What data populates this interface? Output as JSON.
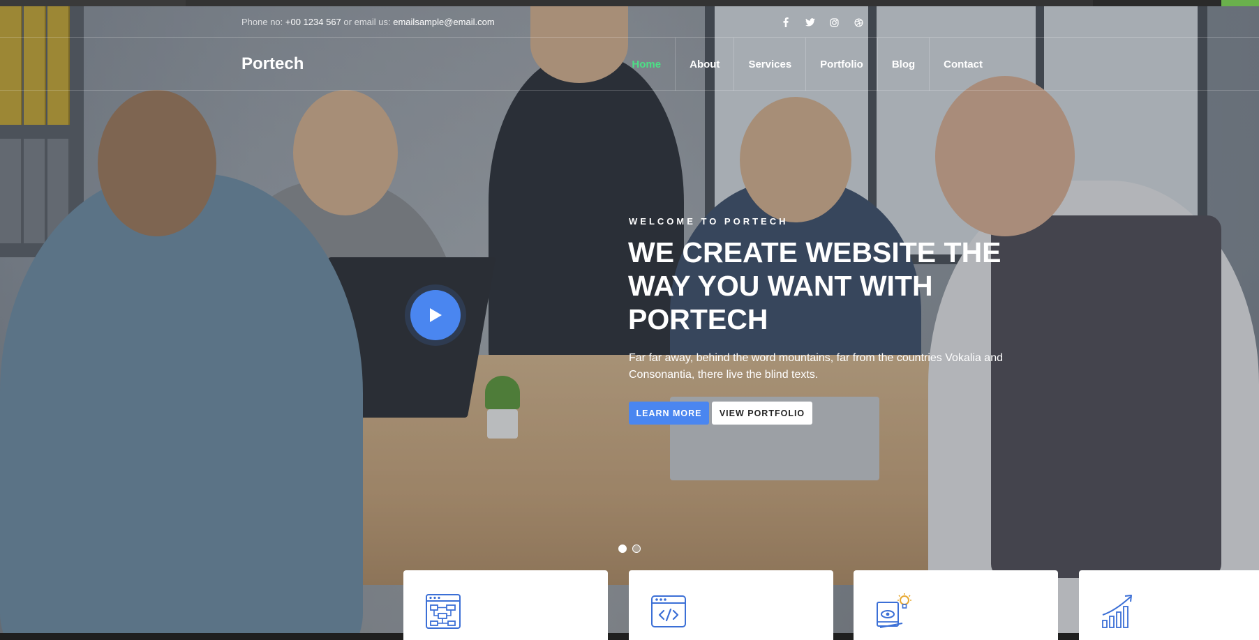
{
  "contact": {
    "phone_label": "Phone no:",
    "phone": "+00 1234 567",
    "email_label": "or email us:",
    "email": "emailsample@email.com"
  },
  "social": [
    {
      "icon": "facebook-icon"
    },
    {
      "icon": "twitter-icon"
    },
    {
      "icon": "instagram-icon"
    },
    {
      "icon": "dribbble-icon"
    }
  ],
  "brand": "Portech",
  "nav": [
    "Home",
    "About",
    "Services",
    "Portfolio",
    "Blog",
    "Contact"
  ],
  "hero": {
    "eyebrow": "WELCOME TO PORTECH",
    "headline": "WE CREATE WEBSITE THE WAY YOU WANT WITH PORTECH",
    "lead": "Far far away, behind the word mountains, far from the countries Vokalia and Consonantia, there live the blind texts.",
    "primary_button": "LEARN MORE",
    "secondary_button": "VIEW PORTFOLIO",
    "slide_count": 2,
    "active_slide": 1
  },
  "cards": [
    {
      "icon": "workflow-icon"
    },
    {
      "icon": "code-window-icon"
    },
    {
      "icon": "design-idea-icon"
    },
    {
      "icon": "growth-chart-icon"
    }
  ],
  "colors": {
    "accent_blue": "#4a86f0",
    "active_nav_green": "#4ce086",
    "icon_blue": "#3b6fd6"
  }
}
